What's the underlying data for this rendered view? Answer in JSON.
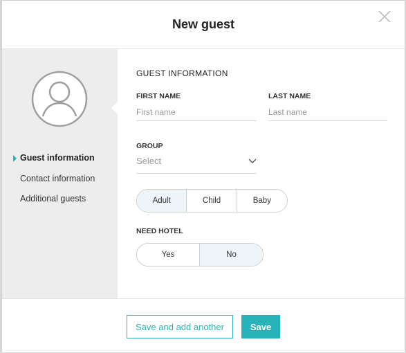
{
  "modal": {
    "title": "New guest"
  },
  "sidebar": {
    "items": [
      {
        "label": "Guest information",
        "active": true
      },
      {
        "label": "Contact information",
        "active": false
      },
      {
        "label": "Additional guests",
        "active": false
      }
    ]
  },
  "form": {
    "section_title": "GUEST INFORMATION",
    "first_name": {
      "label": "FIRST NAME",
      "placeholder": "First name",
      "value": ""
    },
    "last_name": {
      "label": "LAST NAME",
      "placeholder": "Last name",
      "value": ""
    },
    "group": {
      "label": "GROUP",
      "value": "Select"
    },
    "age_type": {
      "options": [
        "Adult",
        "Child",
        "Baby"
      ],
      "selected": "Adult"
    },
    "need_hotel": {
      "label": "NEED HOTEL",
      "options": [
        "Yes",
        "No"
      ],
      "selected": "No"
    }
  },
  "footer": {
    "save_add_label": "Save and add another",
    "save_label": "Save"
  },
  "colors": {
    "accent": "#28b3b8",
    "sidebar_bg": "#ededed",
    "selected_segment_bg": "#eef5f9"
  },
  "icons": {
    "close": "close-icon",
    "avatar": "user-avatar-icon",
    "chevron": "chevron-down-icon",
    "nav_indicator": "triangle-right-icon"
  }
}
